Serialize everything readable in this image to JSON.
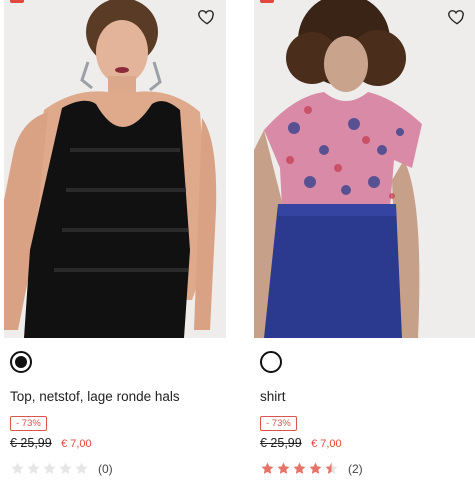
{
  "accent": "#e2483d",
  "products": [
    {
      "title": "Top, netstof, lage ronde hals",
      "discount_badge": "- 73%",
      "old_price": "€ 25,99",
      "new_price": "€ 7,00",
      "rating_stars": 0,
      "rating_count": "(0)",
      "swatch": "black-selected",
      "wishlist_icon": "heart-outline-icon"
    },
    {
      "title": "shirt",
      "discount_badge": "- 73%",
      "old_price": "€ 25,99",
      "new_price": "€ 7,00",
      "rating_stars": 4.5,
      "rating_count": "(2)",
      "swatch": "white",
      "wishlist_icon": "heart-outline-icon"
    }
  ]
}
